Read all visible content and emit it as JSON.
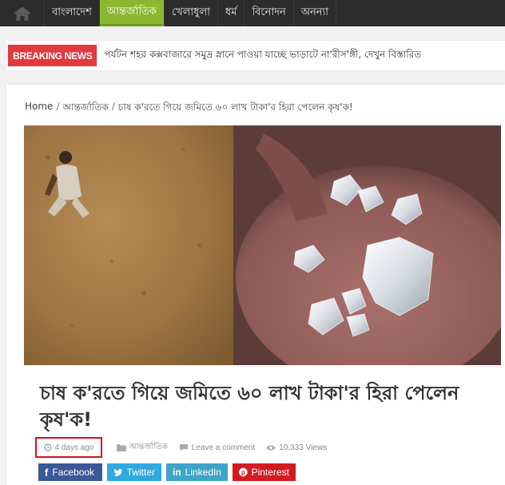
{
  "nav": {
    "home_icon": "home-icon",
    "items": [
      {
        "label": "বাংলাদেশ"
      },
      {
        "label": "আন্তর্জাতিক"
      },
      {
        "label": "খেলাধুলা"
      },
      {
        "label": "ধর্ম"
      },
      {
        "label": "বিনোদন"
      },
      {
        "label": "অনন্যা"
      }
    ],
    "active_index": 1,
    "active_color": "#8bb830"
  },
  "breaking": {
    "tag": "BREAKING NEWS",
    "text": "পর্যটন শহর কক্সবাজারে সমুদ্র স্নানে পাওয়া যাচ্ছে ভাড়াটে না'রীস'ঙ্গী, দেখুন বিস্তারিত",
    "tag_color": "#e0393e"
  },
  "breadcrumb": {
    "home": "Home",
    "sep": "/",
    "category": "আন্তর্জাতিক",
    "current": "চাষ ক'রতে গিয়ে জমিতে ৬০ লাখ টাকা'র হিরা পেলেন কৃষ'ক!"
  },
  "article": {
    "title": "চাষ ক'রতে গিয়ে জমিতে ৬০ লাখ টাকা'র হিরা পেলেন কৃষ'ক!",
    "meta": {
      "date": "4 days ago",
      "category": "আন্তর্জাতিক",
      "comments": "Leave a comment",
      "views": "10,333 Views"
    }
  },
  "share": {
    "facebook": "Facebook",
    "twitter": "Twitter",
    "linkedin": "LinkedIn",
    "pinterest": "Pinterest"
  }
}
